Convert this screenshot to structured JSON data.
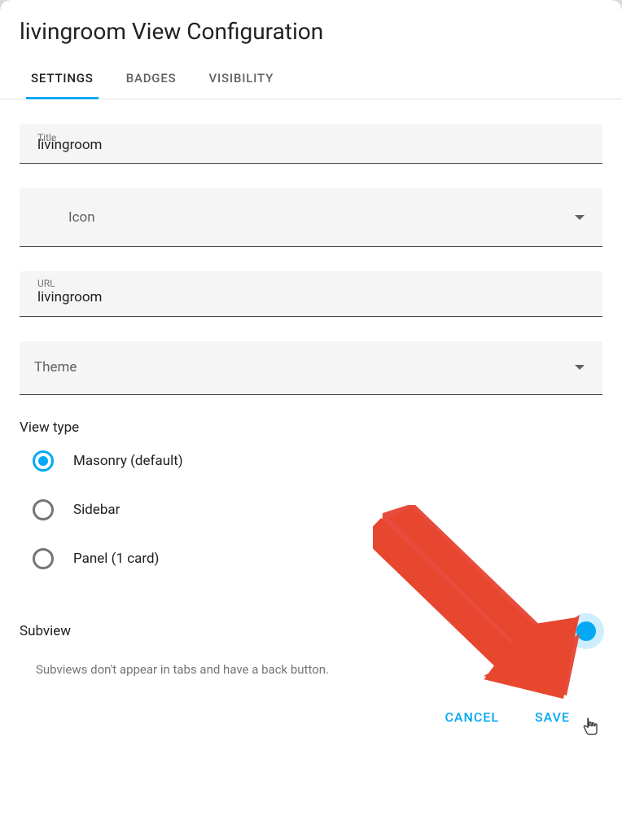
{
  "dialog_title": "livingroom View Configuration",
  "tabs": {
    "settings": "SETTINGS",
    "badges": "BADGES",
    "visibility": "VISIBILITY"
  },
  "title_field": {
    "label": "Title",
    "value": "livingroom"
  },
  "icon_field": {
    "label": "Icon"
  },
  "url_field": {
    "label": "URL",
    "value": "livingroom"
  },
  "theme_field": {
    "label": "Theme"
  },
  "view_type": {
    "section_label": "View type",
    "options": [
      {
        "label": "Masonry (default)"
      },
      {
        "label": "Sidebar"
      },
      {
        "label": "Panel (1 card)"
      }
    ]
  },
  "subview": {
    "label": "Subview",
    "hint": "Subviews don't appear in tabs and have a back button."
  },
  "footer": {
    "cancel": "CANCEL",
    "save": "SAVE"
  }
}
